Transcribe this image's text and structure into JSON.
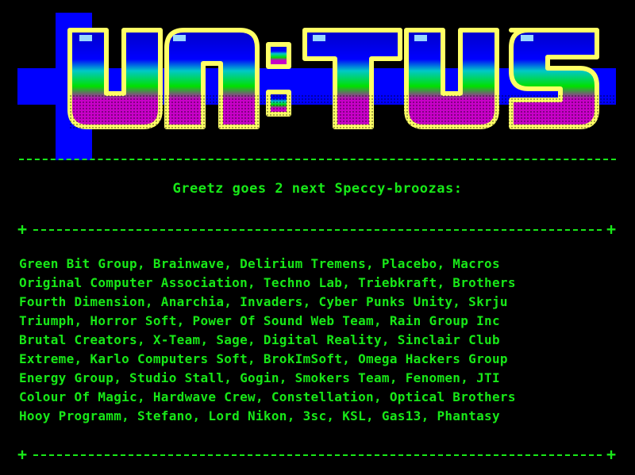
{
  "logo": {
    "text": "UNITUS"
  },
  "colors": {
    "background": "#000000",
    "text": "#18e818",
    "logo_blue": "#0000ff",
    "logo_yellow": "#ffff66",
    "logo_cyan": "#00c8c8",
    "logo_green": "#00e000",
    "logo_magenta": "#c800c8"
  },
  "greetz": {
    "title": "Greetz goes 2 next Speccy-broozas:",
    "lines": [
      "Green Bit Group,  Brainwave, Delirium Tremens,  Placebo, Macros",
      "Original Computer Association, Techno Lab, Triebkraft, Brothers",
      "Fourth Dimension, Anarchia, Invaders, Cyber Punks Unity,  Skrju",
      "Triumph,  Horror Soft,  Power Of Sound Web Team, Rain Group Inc",
      "Brutal Creators,  X-Team, Sage,  Digital Reality, Sinclair Club",
      "Extreme, Karlo Computers Soft, BrokImSoft, Omega Hackers Group",
      "Energy Group,  Studio Stall, Gogin, Smokers Team,  Fenomen, JTI",
      "Colour Of Magic, Hardwave Crew, Constellation, Optical Brothers",
      "Hooy Programm, Stefano, Lord Nikon,  3sc, KSL,  Gas13, Phantasy"
    ]
  }
}
